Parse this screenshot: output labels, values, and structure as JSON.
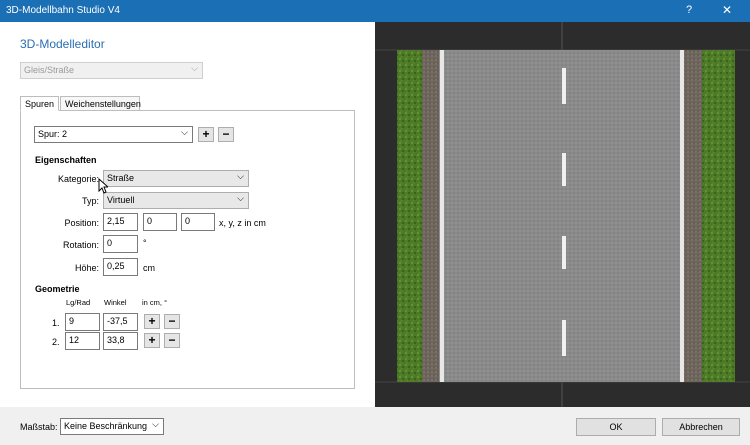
{
  "window": {
    "title": "3D-Modellbahn Studio V4",
    "help": "?",
    "close": "✕"
  },
  "editor": {
    "heading": "3D-Modelleditor",
    "type_select": "Gleis/Straße",
    "tabs": [
      "Spuren",
      "Weichenstellungen"
    ],
    "spur_select": "Spur: 2",
    "add": "+",
    "remove": "−",
    "properties": {
      "header": "Eigenschaften",
      "kategorie_label": "Kategorie:",
      "kategorie_value": "Straße",
      "typ_label": "Typ:",
      "typ_value": "Virtuell",
      "position_label": "Position:",
      "pos_x": "2,15",
      "pos_y": "0",
      "pos_z": "0",
      "pos_unit": "x, y, z in cm",
      "rotation_label": "Rotation:",
      "rotation_value": "0",
      "rotation_unit": "°",
      "hoehe_label": "Höhe:",
      "hoehe_value": "0,25",
      "hoehe_unit": "cm"
    },
    "geometry": {
      "header": "Geometrie",
      "col_lg": "Lg/Rad",
      "col_winkel": "Winkel",
      "col_unit": "in cm, °",
      "rows": [
        {
          "num": "1.",
          "lg": "9",
          "winkel": "-37,5"
        },
        {
          "num": "2.",
          "lg": "12",
          "winkel": "33,8"
        }
      ]
    }
  },
  "footer": {
    "massstab_label": "Maßstab:",
    "massstab_value": "Keine Beschränkung",
    "ok": "OK",
    "cancel": "Abbrechen"
  },
  "colors": {
    "titlebar": "#1a6fb5",
    "heading": "#2a6eb3",
    "asphalt": "#8a8a8a",
    "grass": "#4c7a26"
  },
  "icons": {
    "dropdown": "chevron-down-icon",
    "cursor": "mouse-pointer-icon"
  }
}
